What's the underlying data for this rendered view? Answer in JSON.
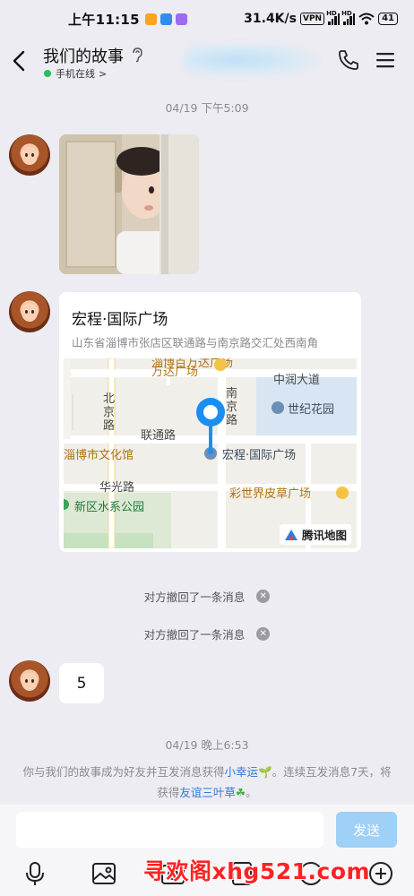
{
  "status_bar": {
    "time": "上午11:15",
    "speed": "31.4K/s",
    "vpn": "VPN",
    "signal_tag": "HD",
    "battery": "41"
  },
  "header": {
    "title": "我们的故事",
    "status": "手机在线",
    "status_chevron": ">"
  },
  "messages": {
    "timestamp_1": "04/19 下午5:09",
    "location": {
      "name": "宏程·国际广场",
      "address": "山东省淄博市张店区联通路与南京路交汇处西南角",
      "map_labels": {
        "top_poi": "淄博百万达广场",
        "wanda": "万达广场",
        "zhongrun": "中润大道",
        "nanjing": "南京路",
        "beijing": "北京路",
        "shiji": "世纪花园",
        "liantong": "联通路",
        "wenhuaguan": "淄博市文化馆",
        "hongcheng": "宏程·国际广场",
        "huaguang": "华光路",
        "caishijie": "彩世界皮草广场",
        "shuixi": "新区水系公园"
      },
      "map_provider": "腾讯地图"
    },
    "recall_1": "对方撤回了一条消息",
    "recall_2": "对方撤回了一条消息",
    "text_message": "5",
    "timestamp_2": "04/19 晚上6:53",
    "notice": {
      "part1": "你与我们的故事成为好友并互发消息获得",
      "link1": "小幸运",
      "part2": "。连续互发消息7天，将获得",
      "link2": "友谊三叶草",
      "part3": "。"
    }
  },
  "input": {
    "value": "",
    "send_label": "发送"
  },
  "watermark": "寻欢阁xhg521.com",
  "colors": {
    "background": "#ececf2",
    "online": "#22c35a",
    "link": "#2f79d6",
    "send_button": "#9fd0f5",
    "watermark": "#ff2222",
    "map_pin": "#1b8ff0"
  }
}
